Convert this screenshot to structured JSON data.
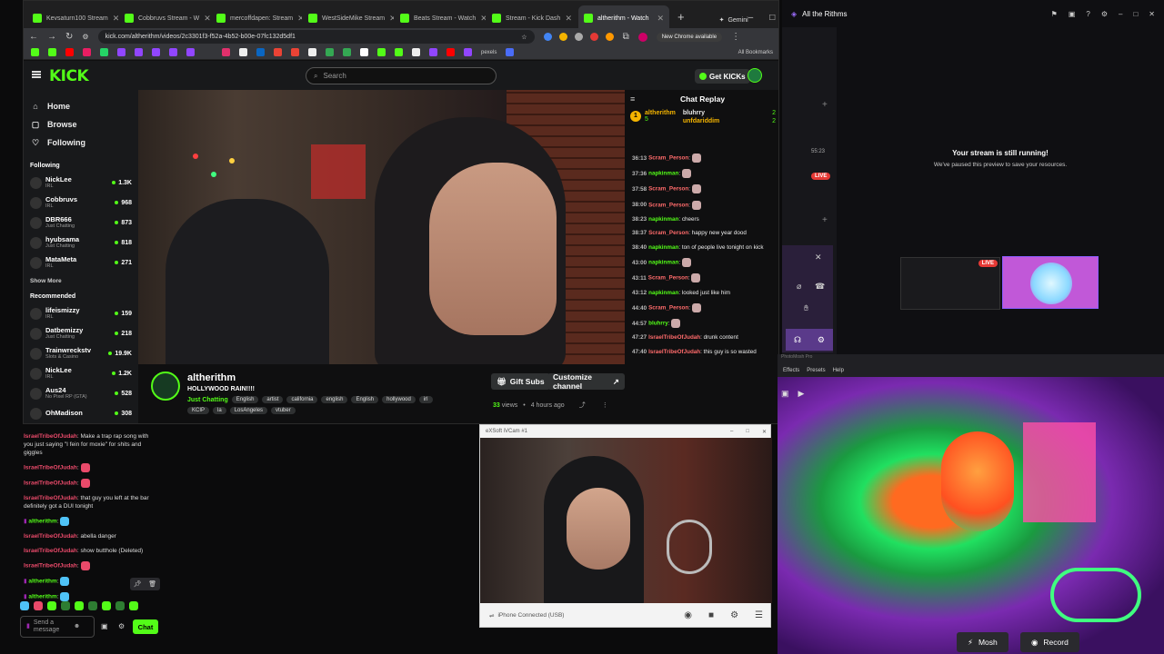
{
  "browser": {
    "tabs": [
      {
        "label": "Kevsaturn100 Stream",
        "color": "#53fc18"
      },
      {
        "label": "Cobbruvs Stream - W",
        "color": "#53fc18"
      },
      {
        "label": "mercoffdapen: Stream",
        "color": "#53fc18"
      },
      {
        "label": "WestSideMike Stream",
        "color": "#53fc18"
      },
      {
        "label": "Beats Stream - Watch",
        "color": "#53fc18"
      },
      {
        "label": "Stream - Kick Dash",
        "color": "#53fc18"
      },
      {
        "label": "altherithm - Watch",
        "color": "#53fc18"
      }
    ],
    "gemini_label": "Gemini",
    "url": "kick.com/altherithm/videos/2c3301f3-f52a-4b52-b00e-07fc132d5df1",
    "new_chrome": "New Chrome available",
    "bookmarks_all": "All Bookmarks",
    "bookmark_pexels": "pexels"
  },
  "kick": {
    "logo": "KICK",
    "search_placeholder": "Search",
    "get_kicks": "Get KICKs",
    "nav": {
      "home": "Home",
      "browse": "Browse",
      "following": "Following"
    },
    "following_title": "Following",
    "following": [
      {
        "name": "NickLee",
        "cat": "IRL",
        "viewers": "1.3K"
      },
      {
        "name": "Cobbruvs",
        "cat": "IRL",
        "viewers": "968"
      },
      {
        "name": "DBR666",
        "cat": "Just Chatting",
        "viewers": "873"
      },
      {
        "name": "hyubsama",
        "cat": "Just Chatting",
        "viewers": "818"
      },
      {
        "name": "MataMeta",
        "cat": "IRL",
        "viewers": "271"
      }
    ],
    "show_more": "Show More",
    "recommended_title": "Recommended",
    "recommended": [
      {
        "name": "lifeismizzy",
        "cat": "IRL",
        "viewers": "159"
      },
      {
        "name": "Datbemizzy",
        "cat": "Just Chatting",
        "viewers": "218"
      },
      {
        "name": "Trainwreckstv",
        "cat": "Slots & Casino",
        "viewers": "19.9K"
      },
      {
        "name": "NickLee",
        "cat": "IRL",
        "viewers": "1.2K"
      },
      {
        "name": "Aus24",
        "cat": "No Pixel RP (GTA)",
        "viewers": "528"
      },
      {
        "name": "OhMadison",
        "cat": "",
        "viewers": "308"
      }
    ],
    "channel": {
      "name": "altherithm",
      "title": "HOLLYWOOD RAIN!!!!",
      "category": "Just Chatting",
      "tags": [
        "English",
        "artist",
        "california",
        "english",
        "English",
        "hollywood",
        "irl",
        "KCIP",
        "la",
        "LosAngeles",
        "vtuber"
      ],
      "gift_subs": "Gift Subs",
      "customize": "Customize channel",
      "views": "33",
      "views_label": "views",
      "ago": "4 hours ago"
    },
    "chat_title": "Chat Replay",
    "leaders": [
      {
        "rank": "1",
        "name": "altherithm",
        "count": "5"
      },
      {
        "name": "bluhrry",
        "count": "2"
      },
      {
        "name": "unfdariddim",
        "count": "2"
      }
    ],
    "replay": [
      {
        "t": "36:13",
        "u": "Scram_Person",
        "c": "#ff6b6b",
        "msg": ""
      },
      {
        "t": "37:36",
        "u": "napkinman",
        "c": "#53fc18",
        "msg": ""
      },
      {
        "t": "37:58",
        "u": "Scram_Person",
        "c": "#ff6b6b",
        "msg": ""
      },
      {
        "t": "38:00",
        "u": "Scram_Person",
        "c": "#ff6b6b",
        "msg": ""
      },
      {
        "t": "38:23",
        "u": "napkinman",
        "c": "#53fc18",
        "msg": "cheers"
      },
      {
        "t": "38:37",
        "u": "Scram_Person",
        "c": "#ff6b6b",
        "msg": "happy new year dood"
      },
      {
        "t": "38:40",
        "u": "napkinman",
        "c": "#53fc18",
        "msg": "ton of people live tonight on kick"
      },
      {
        "t": "43:00",
        "u": "napkinman",
        "c": "#53fc18",
        "msg": ""
      },
      {
        "t": "43:11",
        "u": "Scram_Person",
        "c": "#ff6b6b",
        "msg": ""
      },
      {
        "t": "43:12",
        "u": "napkinman",
        "c": "#53fc18",
        "msg": "looked just like him"
      },
      {
        "t": "44:40",
        "u": "Scram_Person",
        "c": "#ff6b6b",
        "msg": ""
      },
      {
        "t": "44:57",
        "u": "bluhrry",
        "c": "#53fc18",
        "msg": ""
      },
      {
        "t": "47:27",
        "u": "IsraelTribeOfJudah",
        "c": "#ff6b6b",
        "msg": "drunk content"
      },
      {
        "t": "47:40",
        "u": "IsraelTribeOfJudah",
        "c": "#ff6b6b",
        "msg": "this guy is so wasted"
      }
    ]
  },
  "lowchat": {
    "msgs": [
      {
        "u": "IsraelTribeOfJudah",
        "msg": "Make a trap rap song with you just saying \"I fein for moxie\" for shits and giggles"
      },
      {
        "u": "IsraelTribeOfJudah",
        "msg": ""
      },
      {
        "u": "IsraelTribeOfJudah",
        "msg": ""
      },
      {
        "u": "IsraelTribeOfJudah",
        "msg": "that guy you left at the bar definitely got a DUI tonight"
      },
      {
        "u": "altherithm",
        "msg": "",
        "me": true
      },
      {
        "u": "IsraelTribeOfJudah",
        "msg": "abella danger"
      },
      {
        "u": "IsraelTribeOfJudah",
        "msg": "show butthole (Deleted)"
      },
      {
        "u": "IsraelTribeOfJudah",
        "msg": ""
      },
      {
        "u": "altherithm",
        "msg": "",
        "me": true
      },
      {
        "u": "altherithm",
        "msg": "",
        "me": true
      }
    ],
    "send_placeholder": "Send a message",
    "chat_button": "Chat"
  },
  "webcam": {
    "title": "eXSoft iVCam #1",
    "status": "iPhone Connected (USB)"
  },
  "rightpanel": {
    "title": "All the Rithms",
    "timer": "55:23",
    "live": "LIVE",
    "running": "Your stream is still running!",
    "paused": "We've paused this preview to save your resources."
  },
  "filterapp": {
    "menu": [
      "Effects",
      "Presets",
      "Help"
    ],
    "app_name": "PhotoMosh Pro",
    "mosh": "Mosh",
    "record": "Record"
  }
}
